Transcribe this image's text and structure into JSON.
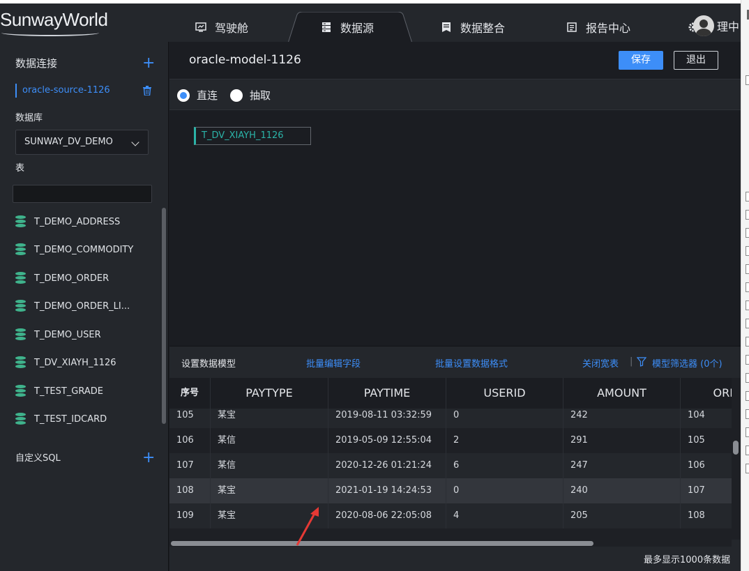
{
  "app": {
    "logo": "SunwayWorld"
  },
  "nav": {
    "tabs": [
      {
        "label": "驾驶舱",
        "icon": "dashboard-icon"
      },
      {
        "label": "数据源",
        "icon": "server-icon",
        "active": true
      },
      {
        "label": "数据整合",
        "icon": "document-icon"
      },
      {
        "label": "报告中心",
        "icon": "report-icon"
      }
    ],
    "user_label": "理中"
  },
  "sidebar": {
    "connections_title": "数据连接",
    "source_name": "oracle-source-1126",
    "database_label": "数据库",
    "database_value": "SUNWAY_DV_DEMO",
    "table_label": "表",
    "tables": [
      "T_DEMO_ADDRESS",
      "T_DEMO_COMMODITY",
      "T_DEMO_ORDER",
      "T_DEMO_ORDER_LI...",
      "T_DEMO_USER",
      "T_DV_XIAYH_1126",
      "T_TEST_GRADE",
      "T_TEST_IDCARD"
    ],
    "custom_sql_label": "自定义SQL"
  },
  "main": {
    "model_name": "oracle-model-1126",
    "save_label": "保存",
    "exit_label": "退出",
    "mode_direct": "直连",
    "mode_extract": "抽取",
    "canvas_node": "T_DV_XIAYH_1126"
  },
  "panel": {
    "title": "设置数据模型",
    "batch_edit": "批量编辑字段",
    "batch_format": "批量设置数据格式",
    "close_wide": "关闭宽表",
    "filter": "模型筛选器 (0个)",
    "footnote": "最多显示1000条数据",
    "columns": [
      "序号",
      "PAYTYPE",
      "PAYTIME",
      "USERID",
      "AMOUNT",
      "ORD"
    ],
    "rows": [
      [
        "105",
        "某宝",
        "2019-08-11 03:32:59",
        "0",
        "242",
        "104"
      ],
      [
        "106",
        "某信",
        "2019-05-09 12:55:04",
        "2",
        "291",
        "105"
      ],
      [
        "107",
        "某信",
        "2020-12-26 01:21:24",
        "6",
        "247",
        "106"
      ],
      [
        "108",
        "某宝",
        "2021-01-19 14:24:53",
        "0",
        "240",
        "107"
      ],
      [
        "109",
        "某宝",
        "2020-08-06 22:05:08",
        "4",
        "205",
        "108"
      ]
    ]
  },
  "colors": {
    "accent": "#3d8ef8",
    "teal": "#2bb3a8",
    "db_green": "#3fb38c",
    "arrow_red": "#e53935"
  }
}
